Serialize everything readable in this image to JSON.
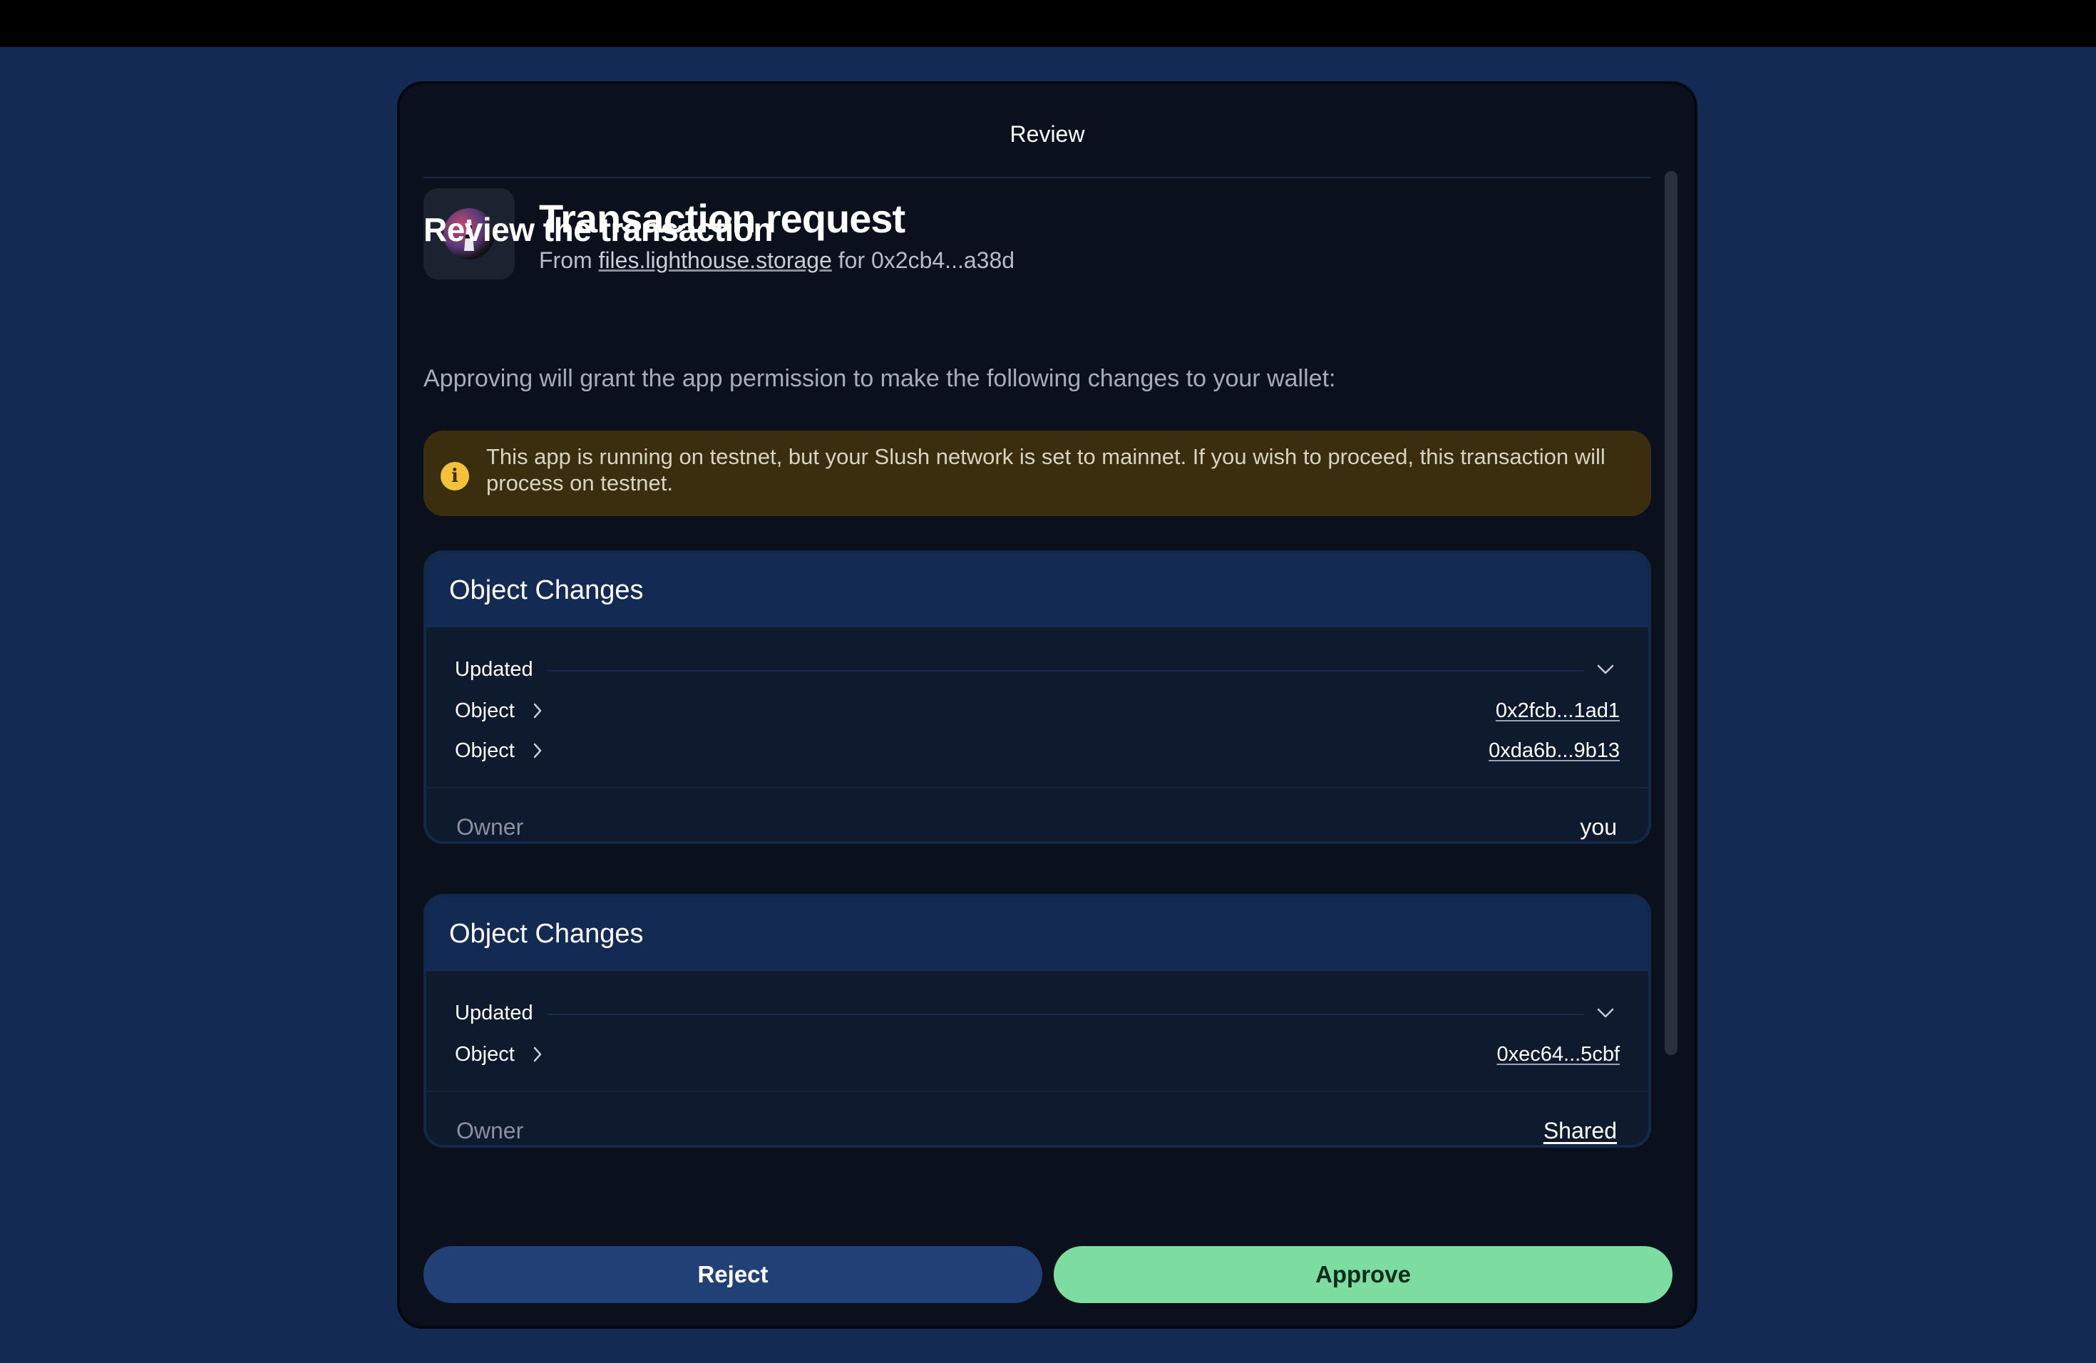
{
  "header": {
    "title": "Review"
  },
  "request": {
    "title": "Transaction request",
    "from_label": "From",
    "origin": "files.lighthouse.storage",
    "for_label": "for",
    "account": "0x2cb4...a38d"
  },
  "review": {
    "title": "Review the transaction",
    "description": "Approving will grant the app permission to make the following changes to your wallet:"
  },
  "warning": {
    "icon": "info-icon",
    "text": "This app is running on testnet, but your Slush network is set to mainnet. If you wish to proceed, this transaction will process on testnet."
  },
  "cards": [
    {
      "title": "Object Changes",
      "group_label": "Updated",
      "objects": [
        {
          "label": "Object",
          "id": "0x2fcb...1ad1"
        },
        {
          "label": "Object",
          "id": "0xda6b...9b13"
        }
      ],
      "owner_label": "Owner",
      "owner_value": "you"
    },
    {
      "title": "Object Changes",
      "group_label": "Updated",
      "objects": [
        {
          "label": "Object",
          "id": "0xec64...5cbf"
        }
      ],
      "owner_label": "Owner",
      "owner_value": "Shared"
    }
  ],
  "actions": {
    "reject_label": "Reject",
    "approve_label": "Approve"
  },
  "colors": {
    "background": "#132a53",
    "modal": "#0a111c",
    "warning_bg": "#3a2e0f",
    "warning_icon": "#f3c23a",
    "approve": "#7ddc9f",
    "reject": "#214075"
  }
}
